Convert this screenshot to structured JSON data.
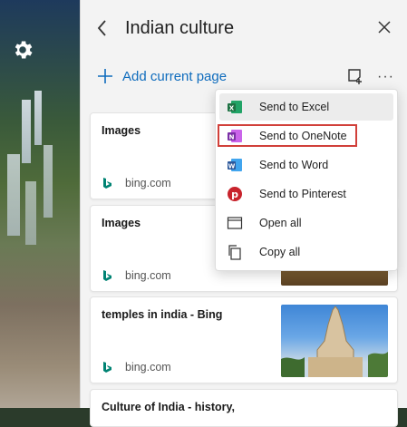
{
  "panel": {
    "title": "Indian culture",
    "add_label": "Add current page"
  },
  "cards": [
    {
      "title": "Images",
      "source": "bing.com"
    },
    {
      "title": "Images",
      "source": "bing.com"
    },
    {
      "title": "temples in india - Bing",
      "source": "bing.com"
    },
    {
      "title": "Culture of India - history,",
      "source": ""
    }
  ],
  "menu": {
    "items": [
      {
        "label": "Send to Excel",
        "icon": "excel-icon"
      },
      {
        "label": "Send to OneNote",
        "icon": "onenote-icon"
      },
      {
        "label": "Send to Word",
        "icon": "word-icon"
      },
      {
        "label": "Send to Pinterest",
        "icon": "pinterest-icon"
      },
      {
        "label": "Open all",
        "icon": "window-icon"
      },
      {
        "label": "Copy all",
        "icon": "copy-icon"
      }
    ],
    "highlighted_item": "Send to OneNote"
  },
  "colors": {
    "accent": "#0f6cbd",
    "excel": "#1f7244",
    "onenote": "#7b2fa6",
    "word": "#2b579a",
    "pinterest": "#c8232c",
    "highlight_box": "#d1403a"
  },
  "icons": {
    "settings": "gear-icon",
    "back": "chevron-left-icon",
    "close": "close-icon",
    "add": "plus-icon",
    "note": "add-note-icon",
    "more": "more-icon",
    "source": "bing-icon"
  }
}
